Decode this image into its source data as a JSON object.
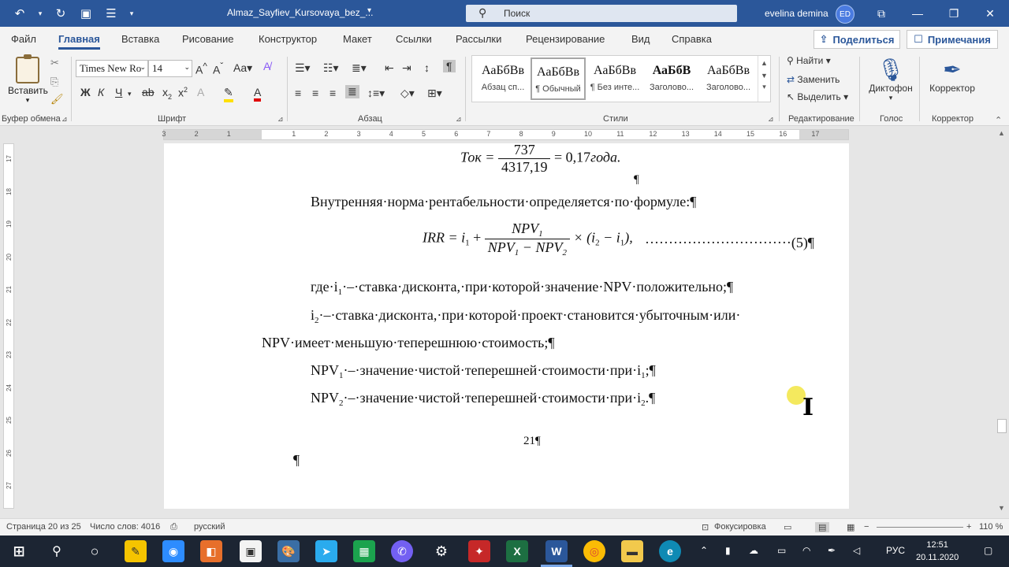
{
  "window": {
    "doc_title": "Almaz_Sayfiev_Kursovaya_bez_...",
    "search_placeholder": "Поиск",
    "user_name": "evelina demina",
    "user_initials": "ED"
  },
  "tabs": [
    "Файл",
    "Главная",
    "Вставка",
    "Рисование",
    "Конструктор",
    "Макет",
    "Ссылки",
    "Рассылки",
    "Рецензирование",
    "Вид",
    "Справка"
  ],
  "actions": {
    "share": "Поделиться",
    "notes": "Примечания"
  },
  "ribbon": {
    "clipboard": {
      "paste": "Вставить",
      "group": "Буфер обмена"
    },
    "font": {
      "name": "Times New Ro",
      "size": "14",
      "group": "Шрифт"
    },
    "paragraph": {
      "group": "Абзац"
    },
    "styles": {
      "group": "Стили",
      "items": [
        {
          "sample": "АаБбВв",
          "name": "Абзац сп..."
        },
        {
          "sample": "АаБбВв",
          "name": "¶ Обычный"
        },
        {
          "sample": "АаБбВв",
          "name": "¶ Без инте..."
        },
        {
          "sample": "АаБбВ",
          "name": "Заголово..."
        },
        {
          "sample": "АаБбВв",
          "name": "Заголово..."
        }
      ]
    },
    "editing": {
      "find": "Найти",
      "replace": "Заменить",
      "select": "Выделить",
      "group": "Редактирование"
    },
    "voice": {
      "dictate": "Диктофон",
      "group": "Голос"
    },
    "editor": {
      "label": "Корректор",
      "group": "Корректор"
    }
  },
  "document": {
    "tok_lhs": "Ток =",
    "tok_num": "737",
    "tok_den": "4317,19",
    "tok_rhs": "= 0,17",
    "tok_unit": "года.",
    "pilcrow": "¶",
    "irr_intro": "Внутренняя·норма·рентабельности·определяется·по·формуле:¶",
    "irr_lhs": "IRR = i",
    "irr_num": "NPV",
    "irr_den_a": "NPV",
    "irr_den_b": "− NPV",
    "irr_tail": "× (i",
    "irr_tail2": " − i",
    "irr_tail3": "),",
    "irr_dots": "·······························(5)¶",
    "sub1": "1",
    "sub2": "2",
    "where_line": "где·i",
    "where_line_rest": "·–·ставка·дисконта,·при·которой·значение·NPV·положительно;¶",
    "i2_line": "i",
    "i2_line_rest": "·–·ставка·дисконта,·при·которой·проект·становится·убыточным·или·",
    "npv_line": "NPV·имеет·меньшую·теперешнюю·стоимость;¶",
    "npv1_a": "NPV",
    "npv1_rest": "·–·значение·чистой·теперешней·стоимости·при·i",
    "npv1_end": ";¶",
    "npv2_a": "NPV",
    "npv2_rest": "·–·значение·чистой·теперешней·стоимости·при·i",
    "npv2_end": ".¶",
    "page_number": "21¶"
  },
  "ruler_numbers": [
    "3",
    "2",
    "1",
    "1",
    "2",
    "3",
    "4",
    "5",
    "6",
    "7",
    "8",
    "9",
    "10",
    "11",
    "12",
    "13",
    "14",
    "15",
    "16",
    "17"
  ],
  "vruler_numbers": [
    "17",
    "18",
    "19",
    "20",
    "21",
    "22",
    "23",
    "24",
    "25",
    "26",
    "27"
  ],
  "status": {
    "page": "Страница 20 из 25",
    "words": "Число слов: 4016",
    "language": "русский",
    "focus": "Фокусировка",
    "zoom": "110 %"
  },
  "taskbar": {
    "lang": "РУС",
    "time": "12:51",
    "date": "20.11.2020"
  }
}
